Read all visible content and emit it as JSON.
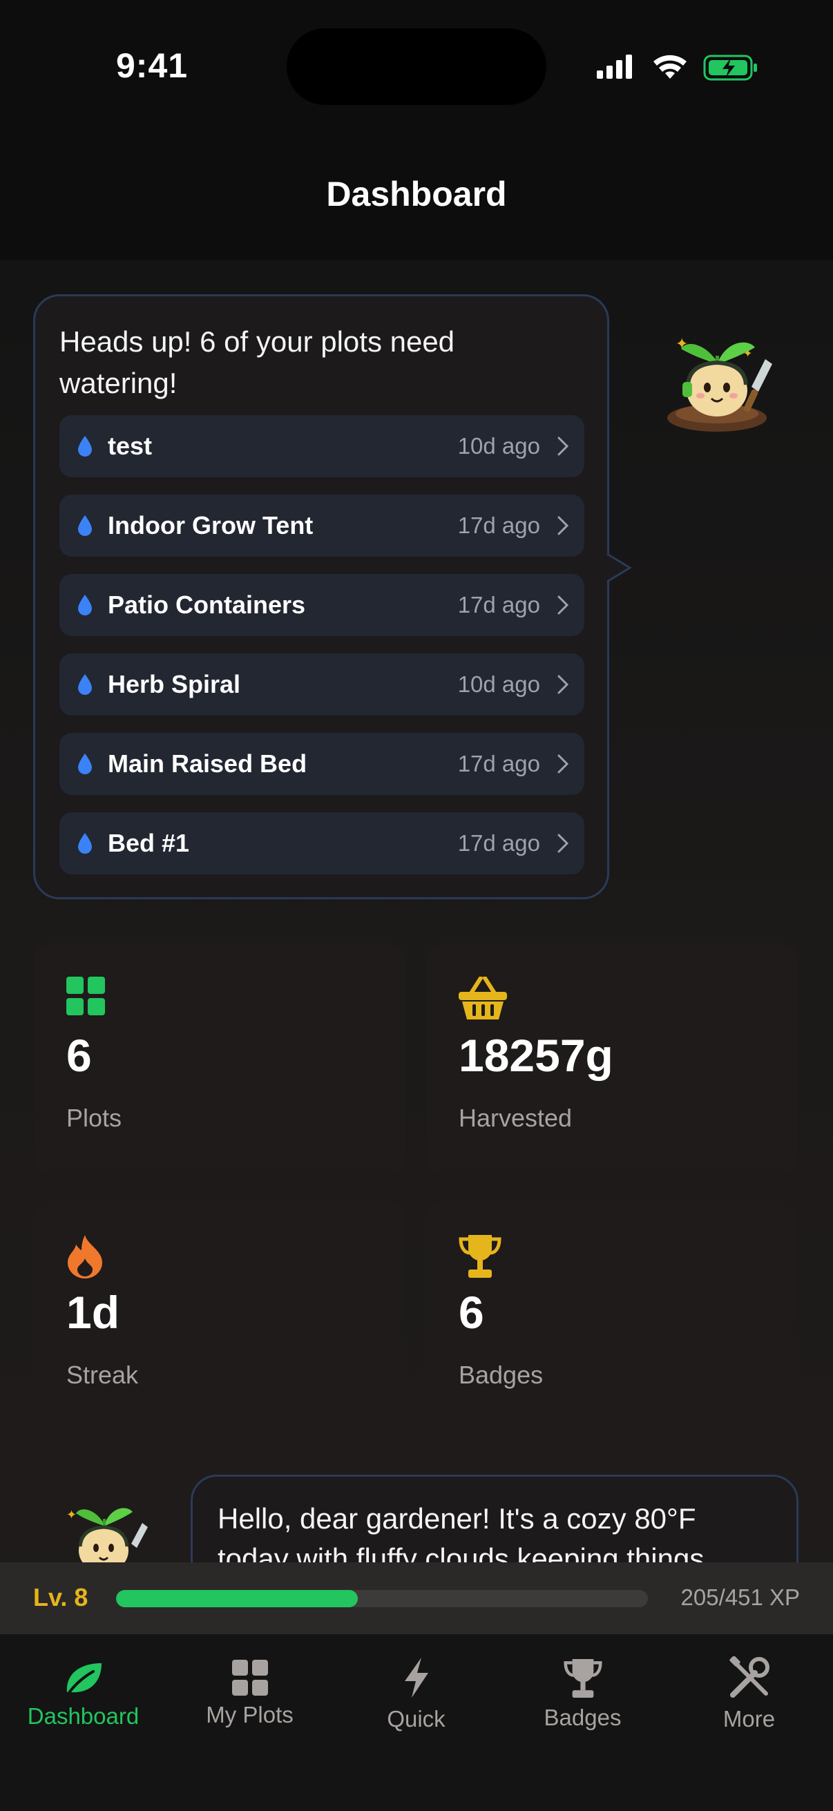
{
  "status_bar": {
    "time": "9:41"
  },
  "header": {
    "title": "Dashboard"
  },
  "watering_alert": {
    "message": "Heads up! 6 of your plots need watering!",
    "plots": [
      {
        "name": "test",
        "last_watered": "10d ago"
      },
      {
        "name": "Indoor Grow Tent",
        "last_watered": "17d ago"
      },
      {
        "name": "Patio Containers",
        "last_watered": "17d ago"
      },
      {
        "name": "Herb Spiral",
        "last_watered": "10d ago"
      },
      {
        "name": "Main Raised Bed",
        "last_watered": "17d ago"
      },
      {
        "name": "Bed #1",
        "last_watered": "17d ago"
      }
    ]
  },
  "stats": {
    "plots": {
      "value": "6",
      "label": "Plots",
      "icon": "grid-icon",
      "color": "#22c55e"
    },
    "harvested": {
      "value": "18257g",
      "label": "Harvested",
      "icon": "basket-icon",
      "color": "#e5b51c"
    },
    "streak": {
      "value": "1d",
      "label": "Streak",
      "icon": "flame-icon",
      "color": "#f0782d"
    },
    "badges": {
      "value": "6",
      "label": "Badges",
      "icon": "trophy-icon",
      "color": "#e5b51c"
    }
  },
  "weather_message": "Hello, dear gardener! It's a cozy 80°F today with fluffy clouds keeping things",
  "xp": {
    "level": "Lv. 8",
    "current": 205,
    "max": 451,
    "text": "205/451 XP"
  },
  "tabs": [
    {
      "label": "Dashboard",
      "icon": "leaf-icon",
      "active": true
    },
    {
      "label": "My Plots",
      "icon": "grid-icon",
      "active": false
    },
    {
      "label": "Quick",
      "icon": "bolt-icon",
      "active": false
    },
    {
      "label": "Badges",
      "icon": "trophy-icon",
      "active": false
    },
    {
      "label": "More",
      "icon": "tools-icon",
      "active": false
    }
  ],
  "colors": {
    "accent": "#22c55e",
    "gold": "#e5b51c",
    "water": "#3b82f6",
    "bubble_border": "#2a3a5a"
  }
}
